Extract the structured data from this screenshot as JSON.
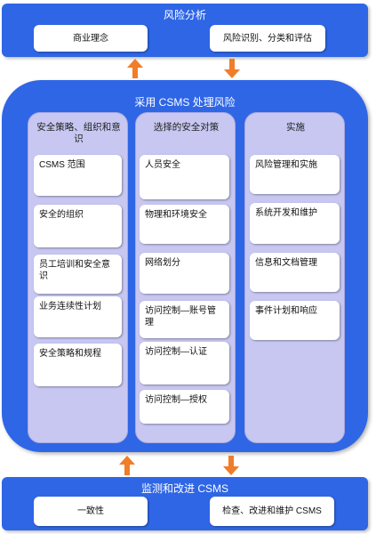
{
  "top_band": {
    "title": "风险分析",
    "items": [
      "商业理念",
      "风险识别、分类和评估"
    ]
  },
  "main_panel": {
    "title": "采用 CSMS 处理风险",
    "columns": [
      {
        "title": "安全策略、组织和意识",
        "items": [
          "CSMS 范围",
          "安全的组织",
          "员工培训和安全意识",
          "业务连续性计划",
          "安全策略和规程"
        ]
      },
      {
        "title": "选择的安全对策",
        "items": [
          "人员安全",
          "物理和环境安全",
          "网络划分",
          "访问控制—账号管理",
          "访问控制—认证",
          "访问控制—授权"
        ]
      },
      {
        "title": "实施",
        "items": [
          "风险管理和实施",
          "系统开发和维护",
          "信息和文档管理",
          "事件计划和响应"
        ]
      }
    ]
  },
  "bottom_band": {
    "title": "监测和改进 CSMS",
    "items": [
      "一致性",
      "检查、改进和维护 CSMS"
    ]
  },
  "colors": {
    "band_blue": "#2f66e6",
    "column_fill": "#c7c7f2",
    "arrow_orange": "#f07d28"
  }
}
